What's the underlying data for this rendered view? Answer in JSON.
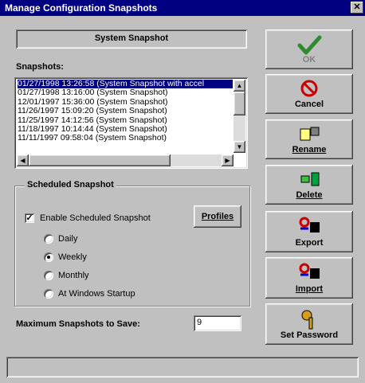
{
  "window": {
    "title": "Manage Configuration Snapshots",
    "close_glyph": "✕"
  },
  "snapshot_box": {
    "label": "System Snapshot"
  },
  "snapshots_label": "Snapshots:",
  "snapshots": [
    "01/27/1998 13:26:58 (System Snapshot with accel",
    "01/27/1998 13:16:00 (System Snapshot)",
    "12/01/1997 15:36:00 (System Snapshot)",
    "11/26/1997 15:09:20 (System Snapshot)",
    "11/25/1997 14:12:56 (System Snapshot)",
    "11/18/1997 10:14:44 (System Snapshot)",
    "11/11/1997 09:58:04 (System Snapshot)"
  ],
  "scheduled": {
    "title": "Scheduled Snapshot",
    "enable_label": "Enable Scheduled Snapshot",
    "enable_checked": true,
    "profiles_label": "Profiles",
    "options": [
      "Daily",
      "Weekly",
      "Monthly",
      "At Windows Startup"
    ],
    "selected": "Weekly"
  },
  "max_label": "Maximum Snapshots to Save:",
  "max_value": "9",
  "buttons": {
    "ok": "OK",
    "cancel": "Cancel",
    "rename": "Rename",
    "delete": "Delete",
    "export": "Export",
    "import": "Import",
    "set_password": "Set Password"
  },
  "colors": {
    "titlebar": "#000080",
    "face": "#c0c0c0",
    "selection": "#000080",
    "ok_check": "#2e8b2e",
    "cancel_red": "#cc0000"
  }
}
